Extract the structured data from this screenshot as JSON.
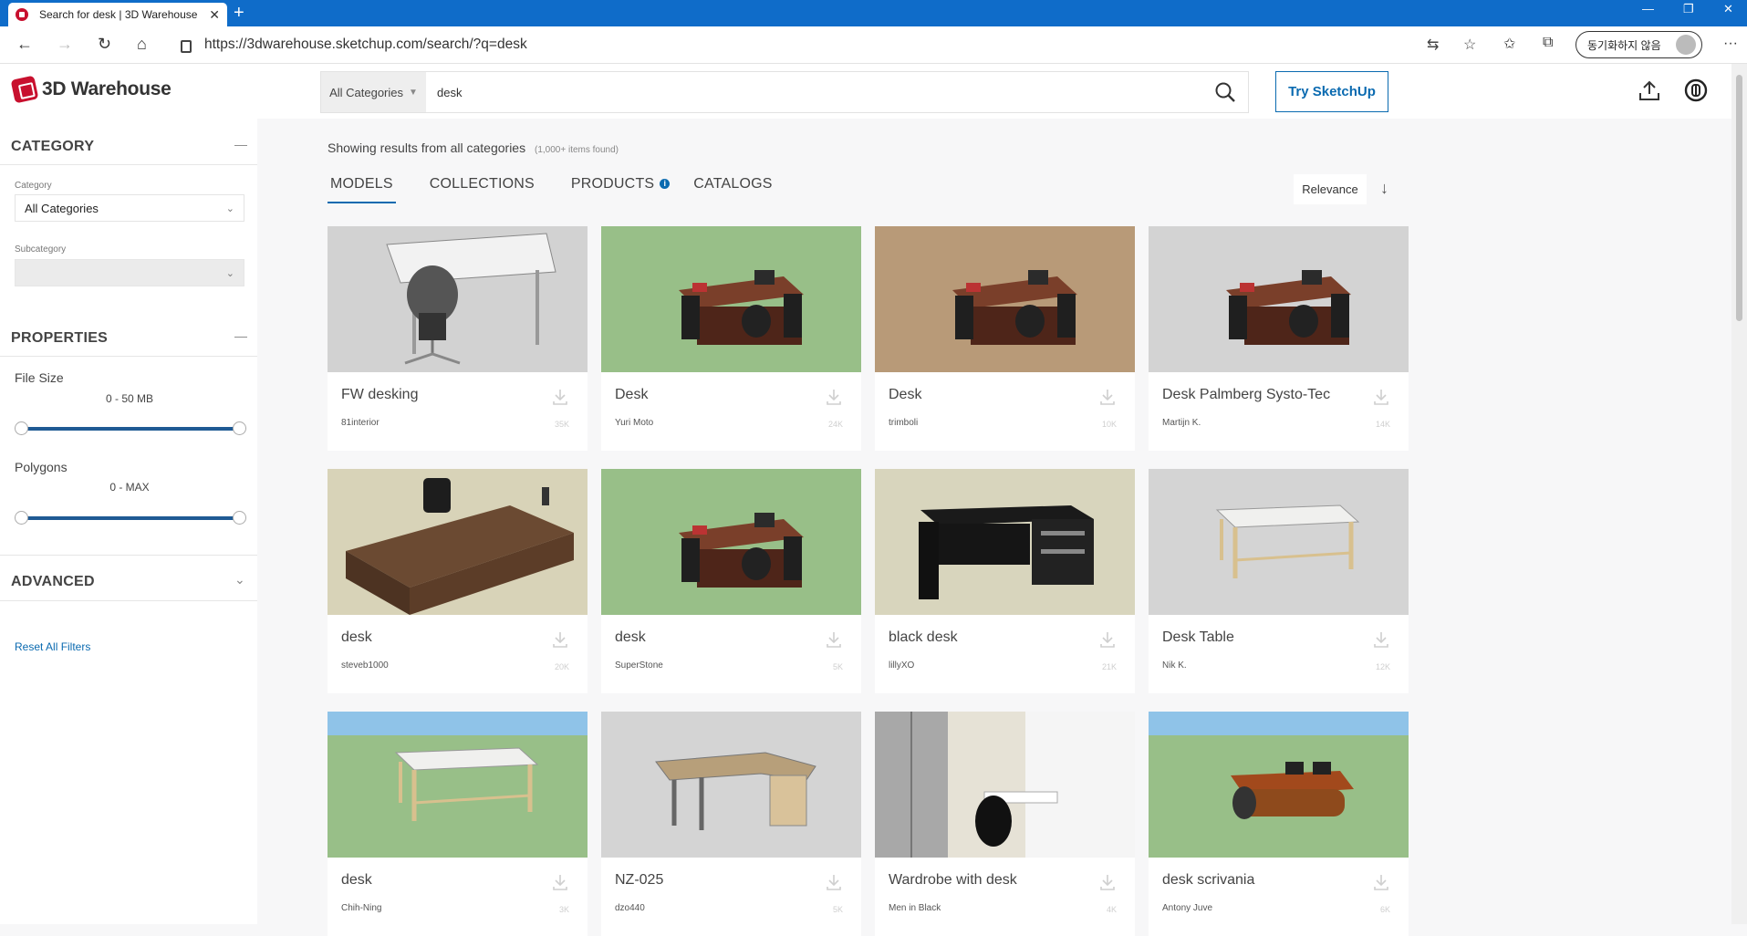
{
  "browser": {
    "tab_title": "Search for desk | 3D Warehouse",
    "url": "https://3dwarehouse.sketchup.com/search/?q=desk",
    "profile_label": "동기화하지 않음"
  },
  "header": {
    "logo_text": "3D Warehouse",
    "category_select": "All Categories",
    "search_value": "desk",
    "try_button": "Try SketchUp"
  },
  "sidebar": {
    "category_heading": "CATEGORY",
    "category_label": "Category",
    "category_value": "All Categories",
    "subcategory_label": "Subcategory",
    "properties_heading": "PROPERTIES",
    "file_size_label": "File Size",
    "file_size_range": "0 - 50 MB",
    "polygons_label": "Polygons",
    "polygons_range": "0 - MAX",
    "advanced_heading": "ADVANCED",
    "reset_label": "Reset All Filters"
  },
  "main": {
    "showing_text": "Showing results from all categories",
    "found_text": "(1,000+ items found)",
    "tabs": [
      {
        "label": "MODELS"
      },
      {
        "label": "COLLECTIONS"
      },
      {
        "label": "PRODUCTS"
      },
      {
        "label": "CATALOGS"
      }
    ],
    "sort_label": "Relevance"
  },
  "results": [
    {
      "name": "FW desking",
      "author": "81interior",
      "count": "35K",
      "bg": "#d2d2d2",
      "icon": "office-chair-desk-icon"
    },
    {
      "name": "Desk",
      "author": "Yuri Moto",
      "count": "24K",
      "bg": "#98bf88",
      "icon": "wood-desk-icon"
    },
    {
      "name": "Desk",
      "author": "trimboli",
      "count": "10K",
      "bg": "#b89a78",
      "icon": "wood-desk-icon"
    },
    {
      "name": "Desk Palmberg Systo-Tec",
      "author": "Martijn K.",
      "count": "14K",
      "bg": "#d3d3d3",
      "icon": "wood-desk-icon"
    },
    {
      "name": "desk",
      "author": "steveb1000",
      "count": "20K",
      "bg": "#d8d3b8",
      "icon": "executive-desk-icon"
    },
    {
      "name": "desk",
      "author": "SuperStone",
      "count": "5K",
      "bg": "#98bf88",
      "icon": "wood-desk-icon"
    },
    {
      "name": "black desk",
      "author": "lillyXO",
      "count": "21K",
      "bg": "#d8d5bd",
      "icon": "black-desk-icon"
    },
    {
      "name": "Desk Table",
      "author": "Nik K.",
      "count": "12K",
      "bg": "#d4d4d4",
      "icon": "table-icon"
    },
    {
      "name": "desk",
      "author": "Chih-Ning",
      "count": "3K",
      "bg": "#98bf88",
      "icon": "table-icon"
    },
    {
      "name": "NZ-025",
      "author": "dzo440",
      "count": "5K",
      "bg": "#d4d4d4",
      "icon": "corner-desk-icon"
    },
    {
      "name": "Wardrobe with desk",
      "author": "Men in Black",
      "count": "4K",
      "bg": "#cfcfcf",
      "icon": "wardrobe-icon"
    },
    {
      "name": "desk scrivania",
      "author": "Antony Juve",
      "count": "6K",
      "bg": "#98bf88",
      "icon": "workstation-icon"
    }
  ],
  "colors": {
    "accent": "#0a6ab0",
    "brand": "#c8102e",
    "titlebar": "#0f6cc9"
  }
}
